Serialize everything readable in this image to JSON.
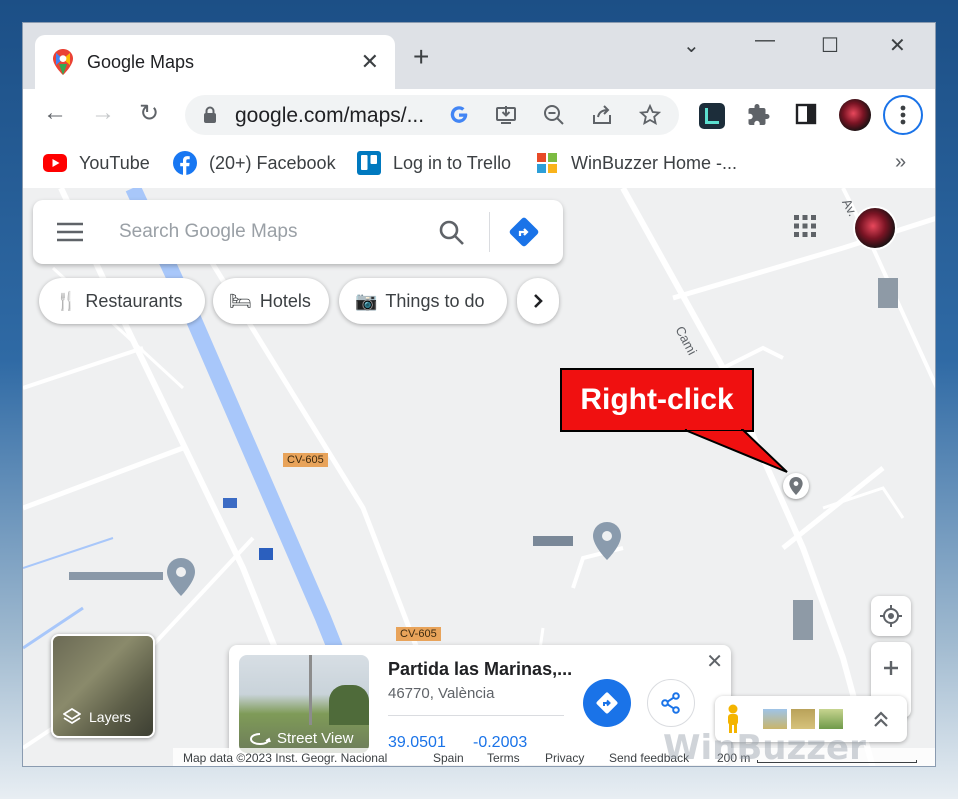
{
  "tab": {
    "title": "Google Maps",
    "close": "✕",
    "new_tab": "+"
  },
  "window": {
    "minimize": "—",
    "maximize": "☐",
    "close": "✕",
    "chevron": "⌄"
  },
  "address_bar": {
    "url": "google.com/maps/..."
  },
  "bookmarks": [
    {
      "label": "YouTube"
    },
    {
      "label": "(20+) Facebook"
    },
    {
      "label": "Log in to Trello"
    },
    {
      "label": "WinBuzzer Home -..."
    }
  ],
  "bookmarks_more": "»",
  "search": {
    "placeholder": "Search Google Maps"
  },
  "chips": [
    {
      "label": "Restaurants"
    },
    {
      "label": "Hotels"
    },
    {
      "label": "Things to do"
    }
  ],
  "road_labels": [
    "CV-605",
    "CV-605"
  ],
  "street_labels": [
    "Cami",
    "Av."
  ],
  "callout": {
    "text": "Right-click"
  },
  "place_card": {
    "title": "Partida las Marinas,...",
    "subtitle": "46770, València",
    "lat": "39.0501",
    "lng": "-0.2003",
    "street_view": "Street View",
    "close": "✕"
  },
  "layers": {
    "label": "Layers"
  },
  "footer": {
    "map_data": "Map data ©2023 Inst. Geogr. Nacional",
    "spain": "Spain",
    "terms": "Terms",
    "privacy": "Privacy",
    "feedback": "Send feedback",
    "scale": "200 m"
  },
  "watermark": "WinBuzzer",
  "colors": {
    "accent": "#1a73e8",
    "callout": "#f01010",
    "road": "#a8c7fa"
  }
}
